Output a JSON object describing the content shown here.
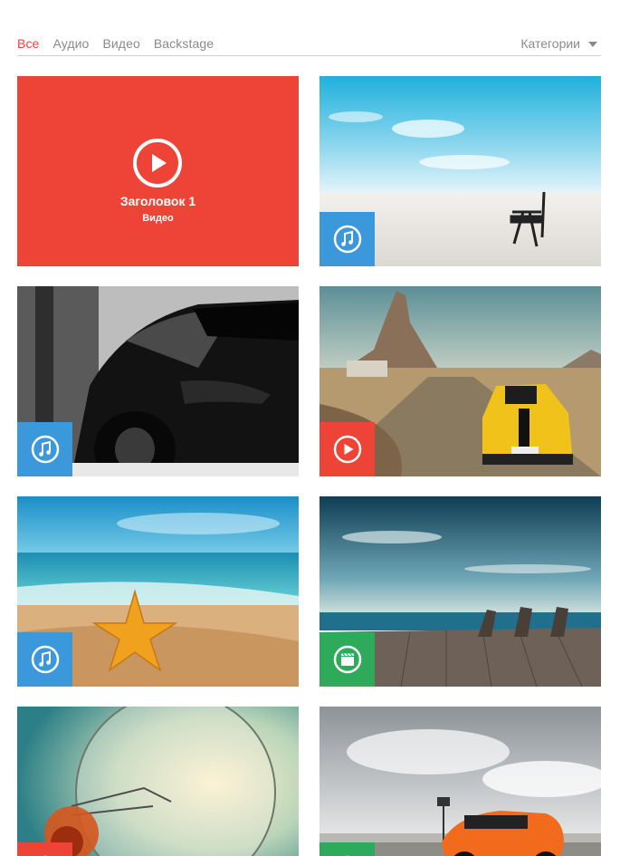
{
  "filter": {
    "tabs": [
      {
        "label": "Все",
        "active": true
      },
      {
        "label": "Аудио",
        "active": false
      },
      {
        "label": "Видео",
        "active": false
      },
      {
        "label": "Backstage",
        "active": false
      }
    ],
    "category_label": "Категории"
  },
  "featured": {
    "title": "Заголовок 1",
    "subtitle": "Видео",
    "color": "#ee4337"
  },
  "tiles": [
    {
      "scene": "desert-chair",
      "badge": "music-note-icon",
      "badge_color": "#3a98db"
    },
    {
      "scene": "black-sports-car",
      "badge": "music-note-icon",
      "badge_color": "#3a98db"
    },
    {
      "scene": "yellow-camaro-desert",
      "badge": "play-icon",
      "badge_color": "#ee4337"
    },
    {
      "scene": "beach-starfish",
      "badge": "music-note-icon",
      "badge_color": "#3a98db"
    },
    {
      "scene": "deck-chairs-sea",
      "badge": "film-clapper-icon",
      "badge_color": "#2eab5a"
    },
    {
      "scene": "light-bulb",
      "badge": "play-icon",
      "badge_color": "#ee4337"
    },
    {
      "scene": "orange-car-road",
      "badge": "film-clapper-icon",
      "badge_color": "#2eab5a"
    }
  ]
}
